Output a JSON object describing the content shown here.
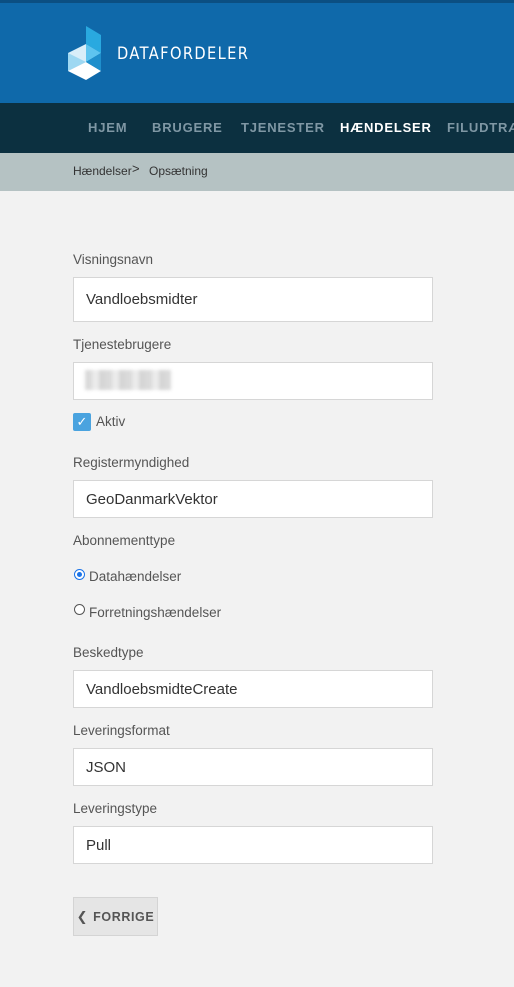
{
  "brand": {
    "name": "DATAFORDELER",
    "logo_icon": "datafordeler-cube-logo"
  },
  "nav": {
    "items": [
      {
        "label": "HJEM",
        "active": false
      },
      {
        "label": "BRUGERE",
        "active": false
      },
      {
        "label": "TJENESTER",
        "active": false
      },
      {
        "label": "HÆNDELSER",
        "active": true
      },
      {
        "label": "FILUDTRÆK",
        "active": false
      }
    ]
  },
  "breadcrumb": {
    "items": [
      "Hændelser",
      "Opsætning"
    ],
    "separator": ">"
  },
  "form": {
    "display_name": {
      "label": "Visningsnavn",
      "value": "Vandloebsmidter"
    },
    "service_users": {
      "label": "Tjenestebrugere",
      "value": ""
    },
    "active": {
      "label": "Aktiv",
      "checked": true
    },
    "authority": {
      "label": "Registermyndighed",
      "value": "GeoDanmarkVektor"
    },
    "subscription_type": {
      "label": "Abonnementtype",
      "options": [
        {
          "label": "Datahændelser",
          "selected": true
        },
        {
          "label": "Forretningshændelser",
          "selected": false
        }
      ]
    },
    "message_type": {
      "label": "Beskedtype",
      "value": "VandloebsmidteCreate"
    },
    "delivery_format": {
      "label": "Leveringsformat",
      "value": "JSON"
    },
    "delivery_type": {
      "label": "Leveringstype",
      "value": "Pull"
    }
  },
  "back_button": {
    "label": "FORRIGE",
    "icon": "chevron-left-icon"
  },
  "colors": {
    "header": "#0f69aa",
    "nav": "#0c3040",
    "breadcrumb": "#b5c2c3",
    "checkbox": "#4aa3df"
  }
}
